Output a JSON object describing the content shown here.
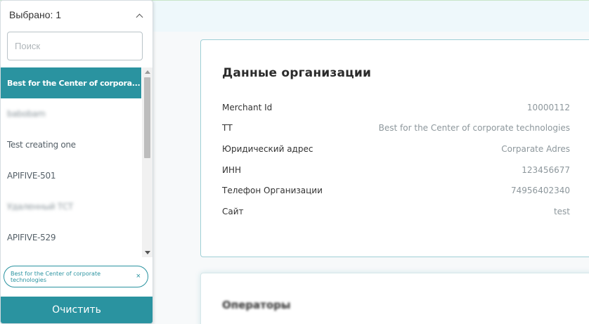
{
  "dropdown": {
    "header_label": "Выбрано: 1",
    "search_placeholder": "Поиск",
    "items": [
      {
        "label": "Best for the Center of corpora..."
      },
      {
        "label": "babobam"
      },
      {
        "label": "Test creating one"
      },
      {
        "label": "APIFIVE-501"
      },
      {
        "label": "Удаленный ТСТ"
      },
      {
        "label": "APIFIVE-529"
      }
    ],
    "selected_chip": "Best for the Center of corporate technologies",
    "chip_close": "×",
    "clear_label": "Очистить"
  },
  "organization": {
    "title": "Данные организации",
    "rows": [
      {
        "label": "Merchant Id",
        "value": "10000112"
      },
      {
        "label": "ТТ",
        "value": "Best for the Center of corporate technologies"
      },
      {
        "label": "Юридический адрес",
        "value": "Corparate Adres"
      },
      {
        "label": "ИНН",
        "value": "123456677"
      },
      {
        "label": "Телефон Организации",
        "value": "74956402340"
      },
      {
        "label": "Сайт",
        "value": "test"
      }
    ]
  },
  "operators": {
    "title": "Операторы"
  },
  "colors": {
    "accent": "#2a93a0",
    "top_strip": "#eef8fb"
  }
}
